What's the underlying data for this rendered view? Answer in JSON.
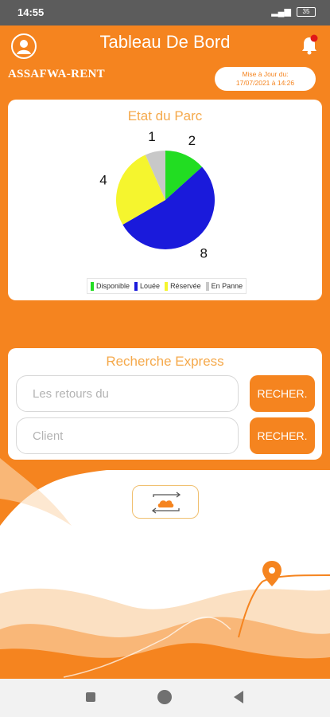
{
  "status_bar": {
    "time": "14:55",
    "battery": "35"
  },
  "header": {
    "title": "Tableau De Bord",
    "company": "ASSAFWA-RENT"
  },
  "update": {
    "label": "Mise à Jour du:",
    "datetime": "17/07/2021 à 14:26"
  },
  "colors": {
    "primary": "#f5841f",
    "title_accent": "#f5a94b"
  },
  "chart_card": {
    "title": "Etat du Parc"
  },
  "chart_data": {
    "type": "pie",
    "title": "Etat du Parc",
    "slices": [
      {
        "label": "Disponible",
        "value": 2,
        "color": "#22dd22"
      },
      {
        "label": "Louée",
        "value": 8,
        "color": "#1a1adb"
      },
      {
        "label": "Réservée",
        "value": 4,
        "color": "#f5f52e"
      },
      {
        "label": "En Panne",
        "value": 1,
        "color": "#c8c8c8"
      }
    ],
    "legend_position": "bottom"
  },
  "search": {
    "title": "Recherche Express",
    "rows": [
      {
        "placeholder": "Les retours du",
        "button": "RECHER."
      },
      {
        "placeholder": "Client",
        "button": "RECHER."
      }
    ]
  },
  "icons": {
    "profile": "user-circle-icon",
    "notifications": "bell-icon",
    "sync": "cloud-sync-icon",
    "location": "map-pin-icon"
  }
}
